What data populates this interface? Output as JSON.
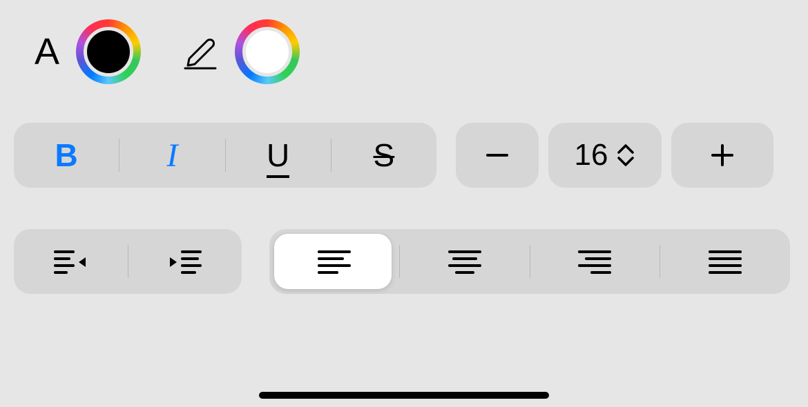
{
  "colors": {
    "text_label": "A",
    "text_color": "#000000",
    "highlight_color": "#ffffff"
  },
  "style": {
    "bold_label": "B",
    "italic_label": "I",
    "underline_label": "U",
    "strike_label": "S",
    "bold_active": true,
    "italic_active": true
  },
  "font_size": {
    "value": "16"
  },
  "alignment": {
    "selected": "left"
  }
}
